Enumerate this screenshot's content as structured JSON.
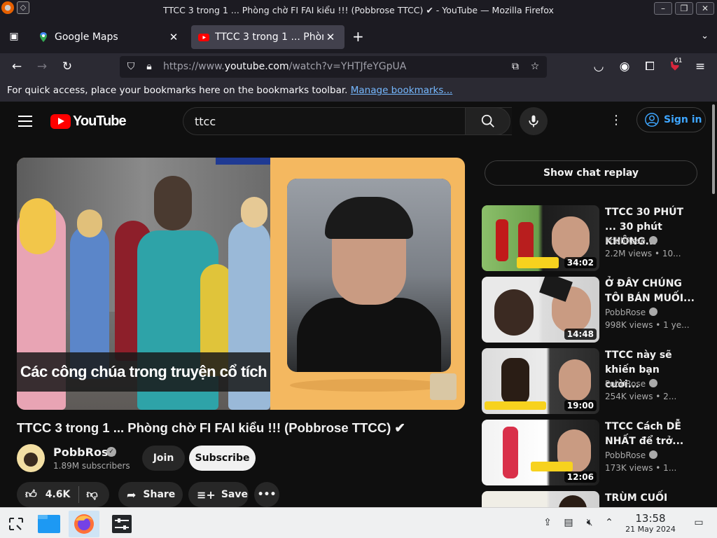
{
  "window": {
    "title": "TTCC 3 trong 1 ... Phòng chờ FI FAI kiểu !!! (Pobbrose TTCC) ✔ - YouTube — Mozilla Firefox"
  },
  "tabs": [
    {
      "label": "Google Maps",
      "icon": "google-maps-icon",
      "active": false
    },
    {
      "label": "TTCC 3 trong 1 ... Phòng",
      "icon": "youtube-icon",
      "active": true
    }
  ],
  "address_bar": {
    "url_prefix": "https://www.",
    "url_domain": "youtube.com",
    "url_suffix": "/watch?v=YHTJfeYGpUA"
  },
  "toolbar": {
    "extensions_badge": "61"
  },
  "bookmarks_bar": {
    "message": "For quick access, place your bookmarks here on the bookmarks toolbar.",
    "link": "Manage bookmarks..."
  },
  "youtube": {
    "logo_text": "YouTube",
    "search_value": "ttcc",
    "sign_in_label": "Sign in",
    "video": {
      "overlay_caption": "Các công chúa trong truyện cổ tích",
      "title": "TTCC 3 trong 1 ... Phòng chờ FI FAI kiểu !!! (Pobbrose TTCC) ✔",
      "channel": "PobbRose",
      "subscribers": "1.89M subscribers",
      "join_label": "Join",
      "subscribe_label": "Subscribe",
      "likes": "4.6K",
      "share_label": "Share",
      "save_label": "Save"
    },
    "chat_replay_label": "Show chat replay",
    "recommendations": [
      {
        "title": "TTCC 30 PHÚT ... 30 phút KHÔNG...",
        "channel": "PobbRose",
        "meta": "2.2M views • 10...",
        "duration": "34:02"
      },
      {
        "title": "Ở ĐÂY CHÚNG TÔI BÁN MUỐI...",
        "channel": "PobbRose",
        "meta": "998K views • 1 ye...",
        "duration": "14:48"
      },
      {
        "title": "TTCC này sẽ khiến bạn cười...",
        "channel": "PobbRose",
        "meta": "254K views • 2...",
        "duration": "19:00"
      },
      {
        "title": "TTCC Cách DỄ NHẤT để trở...",
        "channel": "PobbRose",
        "meta": "173K views • 1...",
        "duration": "12:06"
      },
      {
        "title": "TRÙM CUỐI",
        "channel": "",
        "meta": "",
        "duration": ""
      }
    ]
  },
  "taskbar": {
    "time": "13:58",
    "date": "21 May 2024"
  }
}
